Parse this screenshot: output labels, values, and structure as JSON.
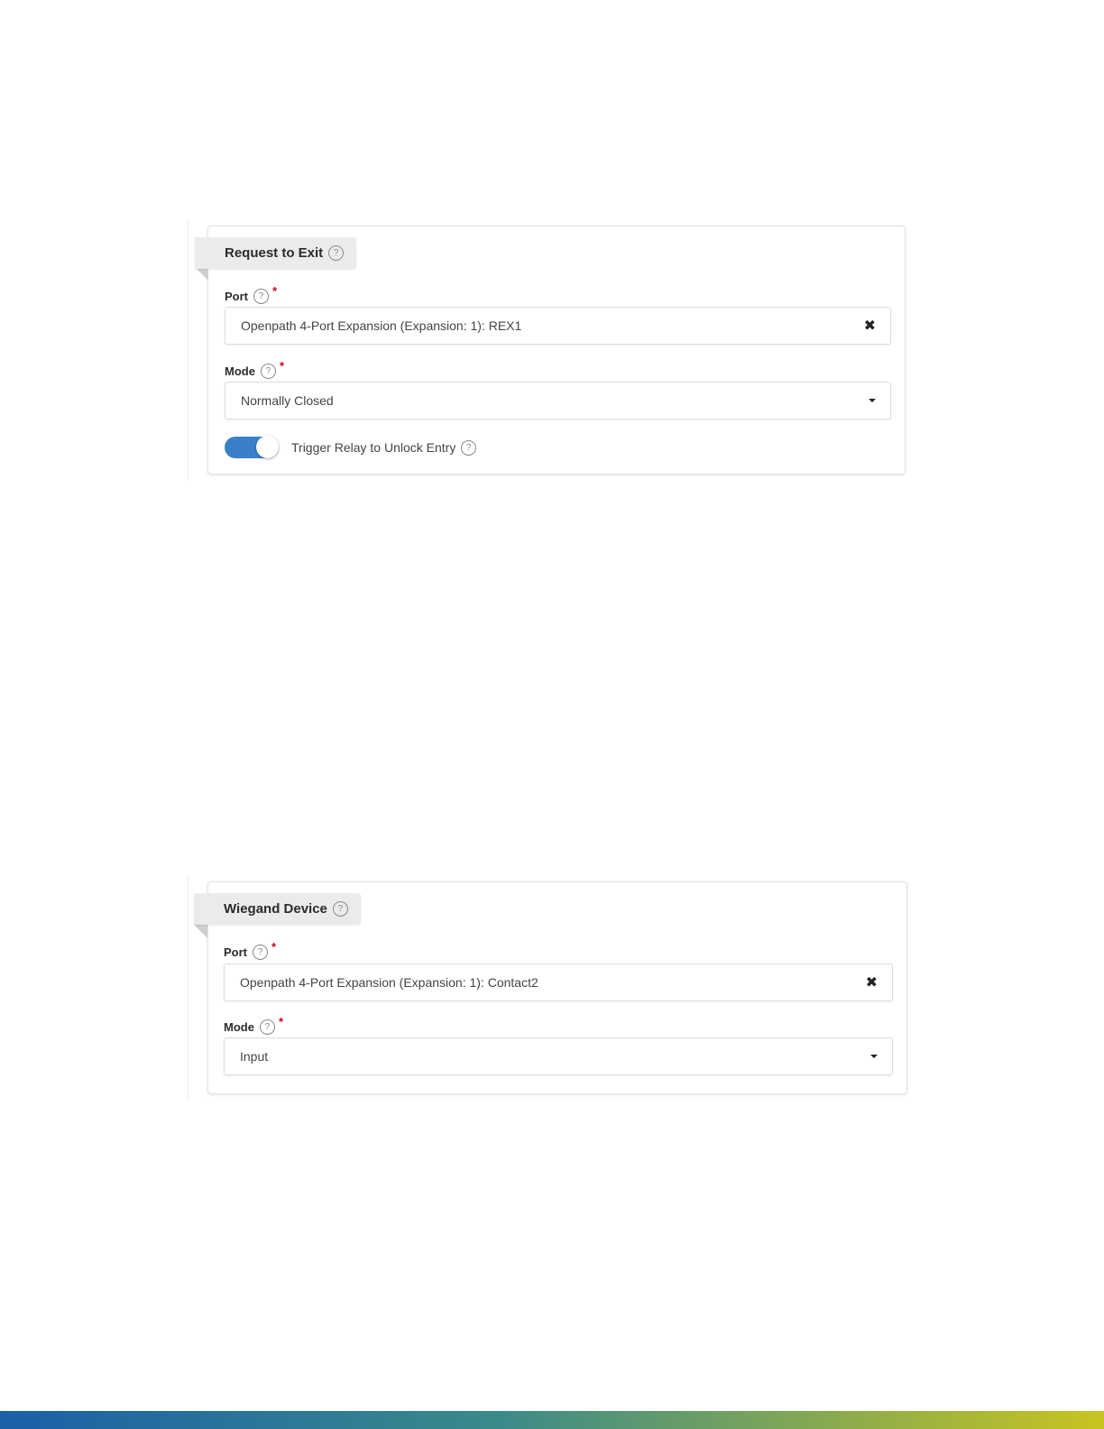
{
  "request_to_exit": {
    "title": "Request to Exit",
    "port": {
      "label": "Port",
      "required_mark": "*",
      "value": "Openpath 4-Port Expansion (Expansion: 1): REX1"
    },
    "mode": {
      "label": "Mode",
      "required_mark": "*",
      "value": "Normally Closed"
    },
    "toggle": {
      "label": "Trigger Relay to Unlock Entry",
      "enabled": true
    }
  },
  "wiegand_device": {
    "title": "Wiegand Device",
    "port": {
      "label": "Port",
      "required_mark": "*",
      "value": "Openpath 4-Port Expansion (Expansion: 1): Contact2"
    },
    "mode": {
      "label": "Mode",
      "required_mark": "*",
      "value": "Input"
    }
  },
  "icons": {
    "help": "?",
    "clear": "✖"
  },
  "colors": {
    "toggle_on": "#3a7fc9",
    "required": "#d0021b",
    "footer_gradient": [
      "#1b5fa8",
      "#3a8a8a",
      "#c9c420"
    ]
  }
}
